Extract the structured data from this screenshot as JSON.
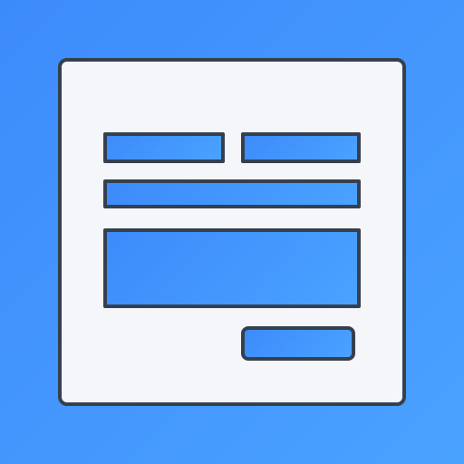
{
  "icon": {
    "name": "contact-form-icon",
    "colors": {
      "background_start": "#3d8bfb",
      "background_end": "#4aa2ff",
      "card_fill": "#f4f6f9",
      "outline": "#35404f",
      "field_fill": "#4696fd"
    }
  }
}
